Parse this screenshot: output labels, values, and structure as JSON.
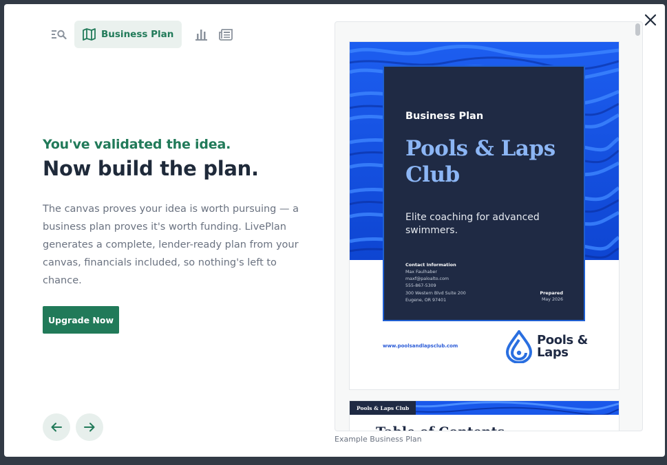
{
  "tabs": {
    "items": [
      {
        "icon": "search-list-icon"
      },
      {
        "icon": "map-icon",
        "label": "Business Plan",
        "active": true
      },
      {
        "icon": "bar-chart-icon"
      },
      {
        "icon": "newspaper-icon"
      }
    ],
    "active_label": "Business Plan"
  },
  "hero": {
    "eyebrow": "You've validated the idea.",
    "headline": "Now build the plan.",
    "body": "The canvas proves your idea is worth pursuing — a business plan proves it's worth funding. LivePlan generates a complete, lender-ready plan from your canvas, financials included, so nothing's left to chance.",
    "cta_label": "Upgrade Now"
  },
  "preview": {
    "caption": "Example Business Plan",
    "cover": {
      "label": "Business Plan",
      "title": "Pools & Laps Club",
      "tagline": "Elite coaching for advanced swimmers.",
      "contact_heading": "Contact Information",
      "contact_lines": "Max Faulhaber\nmaxf@paloalto.com\n555-867-5309\n300 Western Blvd Suite 200\nEugene, OR 97401",
      "prepared_heading": "Prepared",
      "prepared_date": "May 2026",
      "url": "www.poolsandlapsclub.com",
      "logo_text": "Pools & Laps"
    },
    "page2": {
      "tag": "Pools & Laps Club",
      "title": "Table of Contents"
    }
  },
  "colors": {
    "brand_green": "#217a59",
    "navy": "#1f2a44",
    "accent_blue": "#2a5bd7",
    "title_blue": "#8cb6f5",
    "backdrop": "#323a45"
  }
}
